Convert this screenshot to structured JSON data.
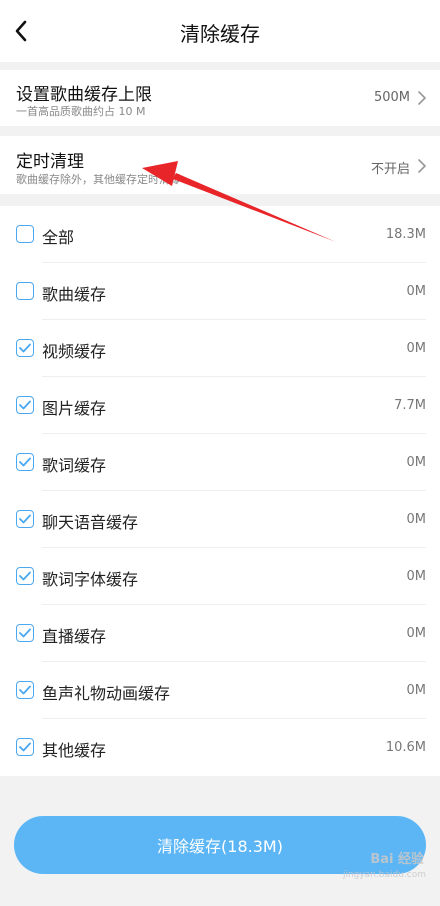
{
  "header": {
    "title": "清除缓存"
  },
  "settings": [
    {
      "title": "设置歌曲缓存上限",
      "subtitle": "一首高品质歌曲约占 10 M",
      "value": "500M"
    },
    {
      "title": "定时清理",
      "subtitle": "歌曲缓存除外，其他缓存定时清零",
      "value": "不开启"
    }
  ],
  "cache_items": [
    {
      "label": "全部",
      "size": "18.3M",
      "checked": false
    },
    {
      "label": "歌曲缓存",
      "size": "0M",
      "checked": false
    },
    {
      "label": "视频缓存",
      "size": "0M",
      "checked": true
    },
    {
      "label": "图片缓存",
      "size": "7.7M",
      "checked": true
    },
    {
      "label": "歌词缓存",
      "size": "0M",
      "checked": true
    },
    {
      "label": "聊天语音缓存",
      "size": "0M",
      "checked": true
    },
    {
      "label": "歌词字体缓存",
      "size": "0M",
      "checked": true
    },
    {
      "label": "直播缓存",
      "size": "0M",
      "checked": true
    },
    {
      "label": "鱼声礼物动画缓存",
      "size": "0M",
      "checked": true
    },
    {
      "label": "其他缓存",
      "size": "10.6M",
      "checked": true
    }
  ],
  "action": {
    "clear_label": "清除缓存(18.3M)"
  },
  "watermark": {
    "text": "Bai 经验",
    "sub": "jingyan.baidu.com"
  },
  "colors": {
    "accent": "#4aa8f0",
    "button": "#5cb6f6",
    "annotation_arrow": "#e8262a"
  }
}
